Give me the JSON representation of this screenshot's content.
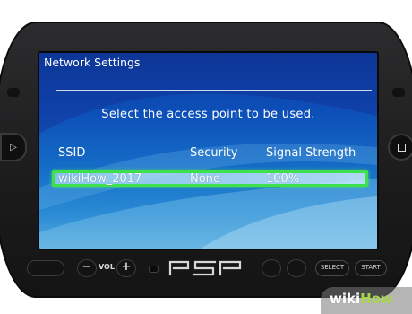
{
  "screen": {
    "title": "Network Settings",
    "prompt": "Select the access point to be used.",
    "columns": [
      "SSID",
      "Security",
      "Signal Strength"
    ],
    "selected_row": {
      "ssid": "wikiHow_2017",
      "security": "None",
      "signal": "100%"
    }
  },
  "device": {
    "vol_label": "VOL",
    "minus": "−",
    "plus": "+",
    "select_label": "SELECT",
    "start_label": "START",
    "logo": "PSP"
  },
  "watermark": {
    "part1": "wiki",
    "part2": "How"
  },
  "colors": {
    "highlight": "#3ee04c",
    "screen_blue": "#0d4fb8",
    "brand_green": "#a6d84a"
  }
}
